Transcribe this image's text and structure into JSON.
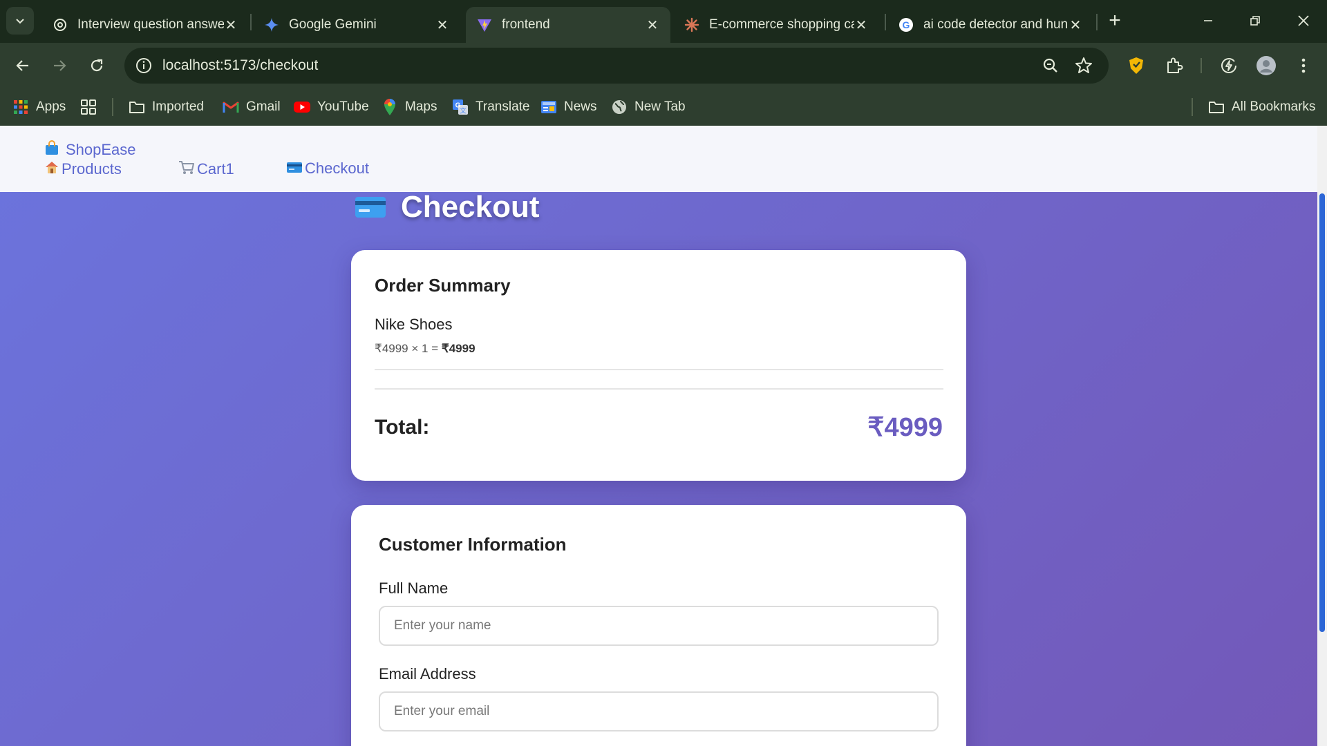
{
  "browser": {
    "tabs": [
      {
        "title": "Interview question answe",
        "icon": "openai-icon"
      },
      {
        "title": "Google Gemini",
        "icon": "gemini-icon"
      },
      {
        "title": "frontend",
        "icon": "vite-icon"
      },
      {
        "title": "E-commerce shopping ca",
        "icon": "claude-icon"
      },
      {
        "title": "ai code detector and hun",
        "icon": "google-icon"
      }
    ],
    "active_tab_index": 2,
    "url": "localhost:5173/checkout",
    "bookmarks": [
      {
        "label": "Apps",
        "icon": "apps-grid-icon"
      },
      {
        "label": "",
        "icon": "tab-groups-icon"
      },
      {
        "label": "Imported",
        "icon": "folder-icon"
      },
      {
        "label": "Gmail",
        "icon": "gmail-icon"
      },
      {
        "label": "YouTube",
        "icon": "youtube-icon"
      },
      {
        "label": "Maps",
        "icon": "maps-icon"
      },
      {
        "label": "Translate",
        "icon": "translate-icon"
      },
      {
        "label": "News",
        "icon": "news-icon"
      },
      {
        "label": "New Tab",
        "icon": "globe-icon"
      }
    ],
    "all_bookmarks": "All Bookmarks"
  },
  "site": {
    "brand": "ShopEase",
    "nav": {
      "products": "Products",
      "cart": "Cart1",
      "checkout": "Checkout"
    }
  },
  "checkout": {
    "title": "Checkout",
    "summary": {
      "heading": "Order Summary",
      "items": [
        {
          "name": "Nike Shoes",
          "price": "₹4999",
          "qty": "1",
          "subtotal": "₹4999"
        }
      ],
      "total_label": "Total:",
      "total_value": "₹4999"
    },
    "customer": {
      "heading": "Customer Information",
      "name_label": "Full Name",
      "name_placeholder": "Enter your name",
      "email_label": "Email Address",
      "email_placeholder": "Enter your email"
    }
  },
  "colors": {
    "accent": "#6a5cc0",
    "nav_link": "#5b67cf",
    "gradient_start": "#6b74dd",
    "gradient_end": "#7358b8",
    "chrome_dark": "#1b2a1c",
    "chrome_mid": "#2e3e2f"
  }
}
